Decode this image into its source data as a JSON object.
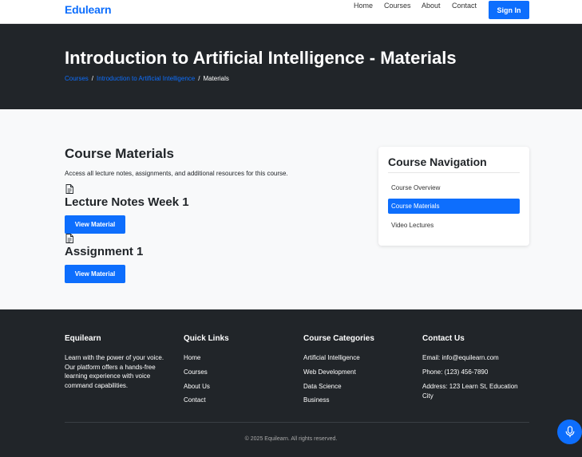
{
  "navbar": {
    "brand": "Edulearn",
    "links": [
      "Home",
      "Courses",
      "About",
      "Contact"
    ],
    "signin_label": "Sign In"
  },
  "hero": {
    "title": "Introduction to Artificial Intelligence - Materials",
    "breadcrumbs": [
      "Courses",
      "Introduction to Artificial Intelligence",
      "Materials"
    ],
    "separator": "/"
  },
  "main": {
    "title": "Course Materials",
    "description": "Access all lecture notes, assignments, and additional resources for this course.",
    "materials": [
      {
        "title": "Lecture Notes Week 1",
        "button_label": "View Material"
      },
      {
        "title": "Assignment 1",
        "button_label": "View Material"
      }
    ]
  },
  "course_nav": {
    "title": "Course Navigation",
    "items": [
      {
        "label": "Course Overview",
        "active": false
      },
      {
        "label": "Course Materials",
        "active": true
      },
      {
        "label": "Video Lectures",
        "active": false
      }
    ]
  },
  "footer": {
    "about": {
      "heading": "Equilearn",
      "text": "Learn with the power of your voice. Our platform offers a hands-free learning experience with voice command capabilities."
    },
    "quick_links": {
      "heading": "Quick Links",
      "items": [
        "Home",
        "Courses",
        "About Us",
        "Contact"
      ]
    },
    "categories": {
      "heading": "Course Categories",
      "items": [
        "Artificial Intelligence",
        "Web Development",
        "Data Science",
        "Business"
      ]
    },
    "contact": {
      "heading": "Contact Us",
      "email": "Email: info@equilearn.com",
      "phone": "Phone: (123) 456-7890",
      "address": "Address: 123 Learn St, Education City"
    },
    "copyright": "© 2025 Equilearn. All rights reserved."
  },
  "colors": {
    "primary": "#0d6efd",
    "dark": "#212529",
    "light_bg": "#f8f9fa"
  },
  "icons": [
    "document-icon",
    "microphone-icon"
  ]
}
